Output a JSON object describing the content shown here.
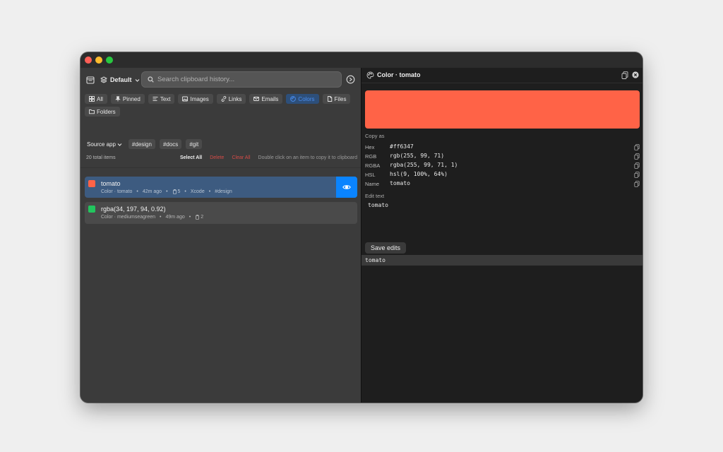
{
  "toolbar": {
    "profile_label": "Default",
    "search_placeholder": "Search clipboard history..."
  },
  "filters": [
    {
      "label": "All",
      "icon": "grid-icon",
      "active": false
    },
    {
      "label": "Pinned",
      "icon": "pin-icon",
      "active": false
    },
    {
      "label": "Text",
      "icon": "text-icon",
      "active": false
    },
    {
      "label": "Images",
      "icon": "image-icon",
      "active": false
    },
    {
      "label": "Links",
      "icon": "link-icon",
      "active": false
    },
    {
      "label": "Emails",
      "icon": "mail-icon",
      "active": false
    },
    {
      "label": "Colors",
      "icon": "palette-icon",
      "active": true
    },
    {
      "label": "Files",
      "icon": "file-icon",
      "active": false
    },
    {
      "label": "Folders",
      "icon": "folder-icon",
      "active": false
    }
  ],
  "tag_row": {
    "source_label": "Source app",
    "tags": [
      "#design",
      "#docs",
      "#git"
    ]
  },
  "status": {
    "total": "20 total items",
    "select_all": "Select All",
    "delete": "Delete",
    "clear_all": "Clear All",
    "hint": "Double click on an item to copy it to clipboard"
  },
  "items": [
    {
      "title": "tomato",
      "swatch": "#ff6347",
      "kind": "Color · tomato",
      "age": "42m ago",
      "copies": "5",
      "app": "Xcode",
      "tag": "#design"
    },
    {
      "title": "rgba(34, 197, 94, 0.92)",
      "swatch": "#22c55e",
      "kind": "Color · mediumseagreen",
      "age": "49m ago",
      "copies": "2"
    }
  ],
  "detail": {
    "title": "Color · tomato",
    "preview_color": "#ff6347",
    "copy_as_label": "Copy as",
    "formats": [
      {
        "label": "Hex",
        "value": "#ff6347"
      },
      {
        "label": "RGB",
        "value": "rgb(255, 99, 71)"
      },
      {
        "label": "RGBA",
        "value": "rgba(255, 99, 71, 1)"
      },
      {
        "label": "HSL",
        "value": "hsl(9, 100%, 64%)"
      },
      {
        "label": "Name",
        "value": "tomato"
      }
    ],
    "edit_label": "Edit text",
    "edit_value": "tomato",
    "save_label": "Save edits",
    "raw_value": "tomato"
  },
  "colors": {
    "accent": "#0a84ff",
    "selected_row": "#3d5b80",
    "danger": "#d44b47"
  }
}
